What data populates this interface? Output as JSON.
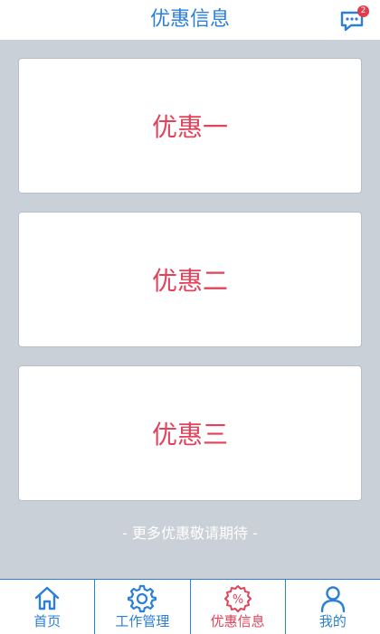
{
  "header": {
    "title": "优惠信息",
    "message_badge": "2"
  },
  "offers": [
    {
      "label": "优惠一"
    },
    {
      "label": "优惠二"
    },
    {
      "label": "优惠三"
    }
  ],
  "footer_note": "- 更多优惠敬请期待 -",
  "tabs": [
    {
      "label": "首页",
      "icon": "home-icon"
    },
    {
      "label": "工作管理",
      "icon": "gear-icon"
    },
    {
      "label": "优惠信息",
      "icon": "discount-icon",
      "active": true
    },
    {
      "label": "我的",
      "icon": "user-icon"
    }
  ],
  "colors": {
    "primary": "#2b7fd8",
    "accent": "#e2425a",
    "background": "#c9d0d7"
  }
}
